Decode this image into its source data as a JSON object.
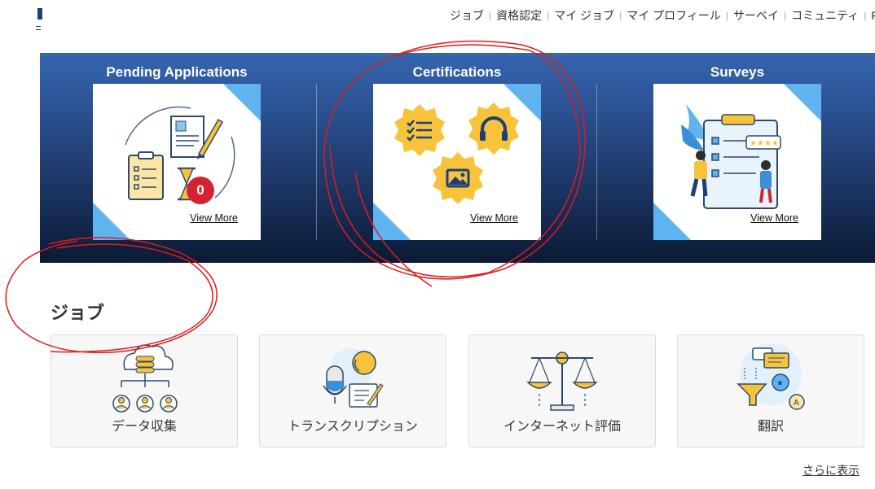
{
  "header": {
    "nav": [
      "ジョブ",
      "資格認定",
      "マイ ジョブ",
      "マイ プロフィール",
      "サーベイ",
      "コミュニティ",
      "F"
    ]
  },
  "banner": {
    "cards": [
      {
        "title": "Pending Applications",
        "link": "View More",
        "badge": "0",
        "icon": "documents-hourglass-icon"
      },
      {
        "title": "Certifications",
        "link": "View More",
        "icon": "certification-badges-icon"
      },
      {
        "title": "Surveys",
        "link": "View More",
        "icon": "survey-clipboard-icon"
      }
    ],
    "colors": {
      "accent": "#5fb4f0",
      "badge": "#d32330",
      "gold": "#f6c33b"
    }
  },
  "jobs": {
    "title": "ジョブ",
    "items": [
      {
        "label": "データ収集",
        "icon": "database-people-icon"
      },
      {
        "label": "トランスクリプション",
        "icon": "microphone-transcription-icon"
      },
      {
        "label": "インターネット評価",
        "icon": "balance-scale-icon"
      },
      {
        "label": "翻訳",
        "icon": "translation-funnel-icon"
      }
    ],
    "more_label": "さらに表示"
  }
}
